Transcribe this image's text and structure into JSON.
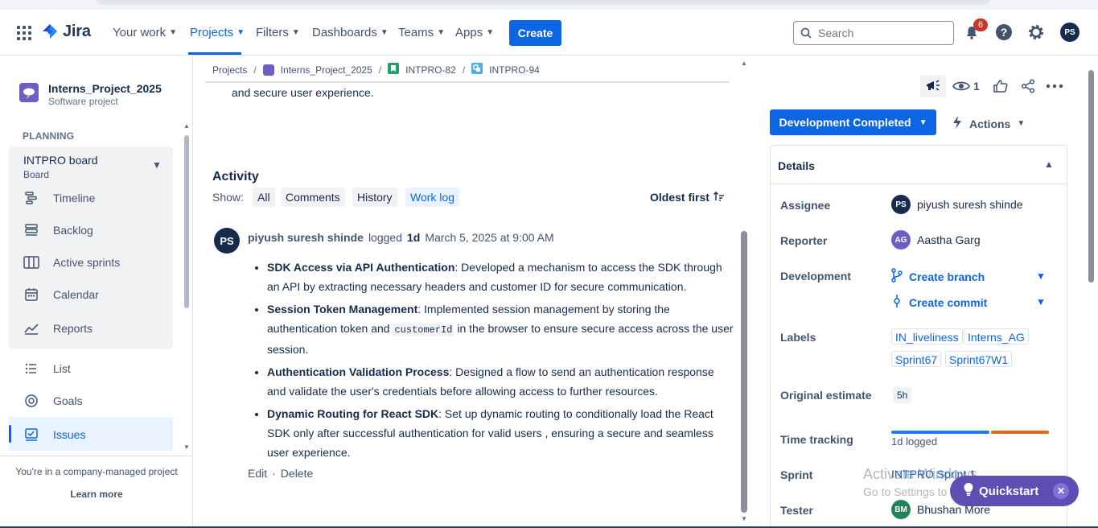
{
  "nav": {
    "app_name": "Jira",
    "items": [
      {
        "label": "Your work"
      },
      {
        "label": "Projects"
      },
      {
        "label": "Filters"
      },
      {
        "label": "Dashboards"
      },
      {
        "label": "Teams"
      },
      {
        "label": "Apps"
      }
    ],
    "active_item": "Projects",
    "create_label": "Create",
    "search_placeholder": "Search",
    "notification_count": "6",
    "user_initials": "PS"
  },
  "sidebar": {
    "project_name": "Interns_Project_2025",
    "project_type": "Software project",
    "section_label": "PLANNING",
    "board_title": "INTPRO board",
    "board_subtitle": "Board",
    "board_items": [
      {
        "label": "Timeline",
        "icon": "timeline-icon"
      },
      {
        "label": "Backlog",
        "icon": "backlog-icon"
      },
      {
        "label": "Active sprints",
        "icon": "active-sprints-icon"
      },
      {
        "label": "Calendar",
        "icon": "calendar-icon"
      },
      {
        "label": "Reports",
        "icon": "reports-icon"
      }
    ],
    "other_items": [
      {
        "label": "List",
        "icon": "list-icon"
      },
      {
        "label": "Goals",
        "icon": "goals-icon"
      },
      {
        "label": "Issues",
        "icon": "issues-icon"
      }
    ],
    "footer_text": "You're in a company-managed project",
    "learn_more": "Learn more"
  },
  "breadcrumb": [
    "Projects",
    "Interns_Project_2025",
    "INTPRO-82",
    "INTPRO-94"
  ],
  "description_tail": "and secure user experience.",
  "activity": {
    "title": "Activity",
    "show_label": "Show:",
    "filters": [
      "All",
      "Comments",
      "History",
      "Work log"
    ],
    "selected_filter": "Work log",
    "sort_label": "Oldest first",
    "log": {
      "avatar_initials": "PS",
      "author": "piyush suresh shinde",
      "verb": "logged",
      "duration": "1d",
      "date": "March 5, 2025 at 9:00 AM",
      "items": [
        {
          "title": "SDK Access via API Authentication",
          "text": ": Developed a mechanism to access the SDK through an API by extracting necessary headers and customer ID for secure communication."
        },
        {
          "title": "Session Token Management",
          "text_before": ": Implemented session management by storing the authentication token and ",
          "code": "customerId",
          "text_after": " in the browser to ensure secure access across the user session."
        },
        {
          "title": "Authentication Validation Process",
          "text": ": Designed a flow to send an authentication response and validate the user's credentials before allowing access to further resources."
        },
        {
          "title": "Dynamic Routing for React SDK",
          "text": ": Set up dynamic routing to conditionally load the React SDK only after successful authentication for valid users , ensuring a secure and seamless user experience."
        }
      ],
      "edit_label": "Edit",
      "separator": "·",
      "delete_label": "Delete"
    }
  },
  "right_panel": {
    "watch_count": "1",
    "status_label": "Development Completed",
    "actions_label": "Actions",
    "details_title": "Details",
    "fields": {
      "assignee_label": "Assignee",
      "assignee_initials": "PS",
      "assignee_name": "piyush suresh shinde",
      "reporter_label": "Reporter",
      "reporter_initials": "AG",
      "reporter_name": "Aastha Garg",
      "development_label": "Development",
      "create_branch": "Create branch",
      "create_commit": "Create commit",
      "labels_label": "Labels",
      "labels": [
        "IN_liveliness",
        "Interns_AG",
        "Sprint67",
        "Sprint67W1"
      ],
      "estimate_label": "Original estimate",
      "estimate_value": "5h",
      "time_tracking_label": "Time tracking",
      "time_logged": "1d logged",
      "time_logged_fraction": 0.62,
      "sprint_label": "Sprint",
      "sprint_value": "INTPRO Sprint 1",
      "tester_label": "Tester",
      "tester_initials": "BM",
      "tester_name": "Bhushan More"
    }
  },
  "overlay": {
    "watermark_title": "Activate Windows",
    "watermark_sub": "Go to Settings to activate Windows.",
    "quickstart_label": "Quickstart"
  },
  "colors": {
    "brand_blue": "#0C66E4",
    "quickstart_purple": "#5E4DB2",
    "time_logged": "#1D7AFC",
    "time_remaining": "#E56910"
  }
}
